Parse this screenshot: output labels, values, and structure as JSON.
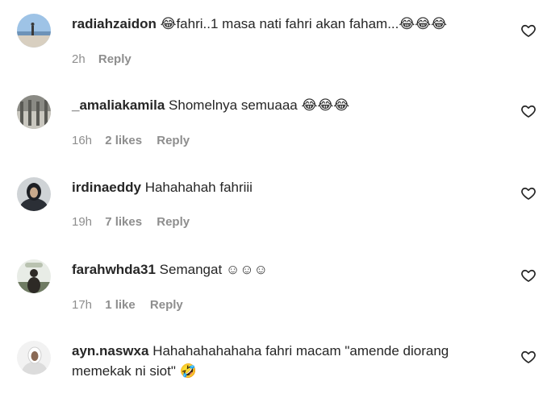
{
  "comments": [
    {
      "username": "radiahzaidon",
      "text": "😂fahri..1 masa nati fahri akan faham...😂😂😂",
      "time": "2h",
      "likes": "",
      "reply_label": "Reply",
      "avatar_colors": {
        "sky": "#9ec3e6",
        "ground": "#d8cfc0",
        "figure": "#3a3a3a"
      }
    },
    {
      "username": "_amaliakamila",
      "text": "Shomelnya semuaaa 😂😂😂",
      "time": "16h",
      "likes": "2 likes",
      "reply_label": "Reply",
      "avatar_colors": {
        "sky": "#8a8a84",
        "ground": "#c9c7bf",
        "figure": "#5a5a55"
      }
    },
    {
      "username": "irdinaeddy",
      "text": "Hahahahah fahriii",
      "time": "19h",
      "likes": "7 likes",
      "reply_label": "Reply",
      "avatar_colors": {
        "sky": "#cfd3d6",
        "ground": "#2b2f36",
        "figure": "#1d1f24"
      }
    },
    {
      "username": "farahwhda31",
      "text": "Semangat ☺☺☺",
      "time": "17h",
      "likes": "1 like",
      "reply_label": "Reply",
      "avatar_colors": {
        "sky": "#e8ece6",
        "ground": "#6f7b63",
        "figure": "#2d2a26"
      }
    },
    {
      "username": "ayn.naswxa",
      "text": "Hahahahahahaha fahri macam \"amende diorang memekak ni siot\" 🤣",
      "time": "",
      "likes": "",
      "reply_label": "",
      "avatar_colors": {
        "sky": "#f2f2f2",
        "ground": "#dcdcdc",
        "figure": "#ffffff"
      }
    }
  ],
  "icons": {
    "like": "heart-outline-icon"
  }
}
